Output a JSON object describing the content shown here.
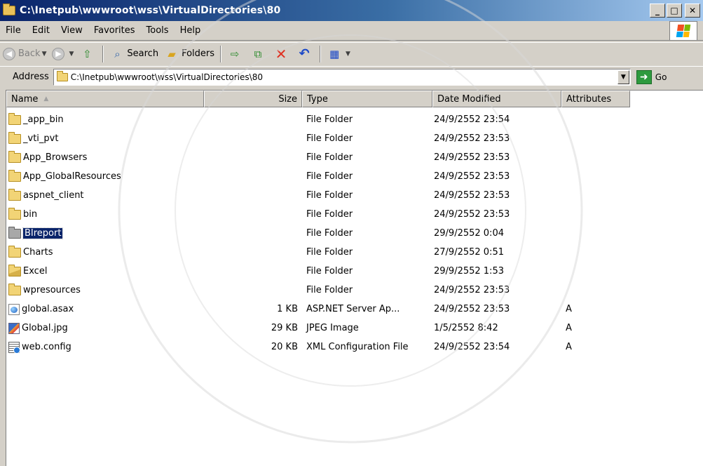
{
  "window": {
    "title": "C:\\Inetpub\\wwwroot\\wss\\VirtualDirectories\\80",
    "controls": {
      "minimize": "_",
      "maximize": "□",
      "close": "✕"
    }
  },
  "menu": [
    "File",
    "Edit",
    "View",
    "Favorites",
    "Tools",
    "Help"
  ],
  "toolbar": {
    "back_label": "Back",
    "search_label": "Search",
    "folders_label": "Folders"
  },
  "address": {
    "label": "Address",
    "value": "C:\\Inetpub\\wwwroot\\wss\\VirtualDirectories\\80",
    "go_label": "Go"
  },
  "columns": {
    "name": "Name",
    "size": "Size",
    "type": "Type",
    "date": "Date Modified",
    "attributes": "Attributes"
  },
  "files": [
    {
      "name": "_app_bin",
      "size": "",
      "type": "File Folder",
      "date": "24/9/2552 23:54",
      "attr": "",
      "icon": "folder-icon"
    },
    {
      "name": "_vti_pvt",
      "size": "",
      "type": "File Folder",
      "date": "24/9/2552 23:53",
      "attr": "",
      "icon": "folder-icon"
    },
    {
      "name": "App_Browsers",
      "size": "",
      "type": "File Folder",
      "date": "24/9/2552 23:53",
      "attr": "",
      "icon": "folder-icon"
    },
    {
      "name": "App_GlobalResources",
      "size": "",
      "type": "File Folder",
      "date": "24/9/2552 23:53",
      "attr": "",
      "icon": "folder-icon"
    },
    {
      "name": "aspnet_client",
      "size": "",
      "type": "File Folder",
      "date": "24/9/2552 23:53",
      "attr": "",
      "icon": "folder-icon"
    },
    {
      "name": "bin",
      "size": "",
      "type": "File Folder",
      "date": "24/9/2552 23:53",
      "attr": "",
      "icon": "folder-icon"
    },
    {
      "name": "BIreport",
      "size": "",
      "type": "File Folder",
      "date": "29/9/2552 0:04",
      "attr": "",
      "icon": "folder-icon",
      "selected": true
    },
    {
      "name": "Charts",
      "size": "",
      "type": "File Folder",
      "date": "27/9/2552 0:51",
      "attr": "",
      "icon": "folder-icon"
    },
    {
      "name": "Excel",
      "size": "",
      "type": "File Folder",
      "date": "29/9/2552 1:53",
      "attr": "",
      "icon": "open-folder-icon"
    },
    {
      "name": "wpresources",
      "size": "",
      "type": "File Folder",
      "date": "24/9/2552 23:53",
      "attr": "",
      "icon": "folder-icon"
    },
    {
      "name": "global.asax",
      "size": "1 KB",
      "type": "ASP.NET Server Ap...",
      "date": "24/9/2552 23:53",
      "attr": "A",
      "icon": "asax-file-icon"
    },
    {
      "name": "Global.jpg",
      "size": "29 KB",
      "type": "JPEG Image",
      "date": "1/5/2552 8:42",
      "attr": "A",
      "icon": "jpeg-file-icon"
    },
    {
      "name": "web.config",
      "size": "20 KB",
      "type": "XML Configuration File",
      "date": "24/9/2552 23:54",
      "attr": "A",
      "icon": "config-file-icon"
    }
  ],
  "colors": {
    "title_start": "#0a246a",
    "title_end": "#a6caf0",
    "selection": "#0a246a",
    "chrome": "#d4d0c8"
  }
}
